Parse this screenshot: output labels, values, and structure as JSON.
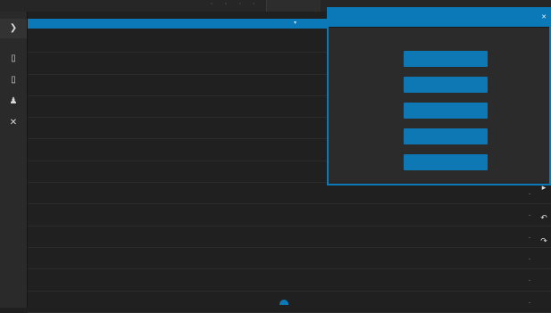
{
  "topbar": {
    "title": ""
  },
  "sidebar": {
    "items": [
      {
        "icon": "expand-icon",
        "glyph": "❯",
        "label": ""
      },
      {
        "icon": "document-icon",
        "glyph": "▯",
        "label": ""
      },
      {
        "icon": "page-icon",
        "glyph": "▯",
        "label": ""
      },
      {
        "icon": "person-icon",
        "glyph": "♟",
        "label": ""
      },
      {
        "icon": "tools-icon",
        "glyph": "✕",
        "label": ""
      }
    ]
  },
  "list": {
    "header": "",
    "rows": [
      {
        "label": "",
        "id": "",
        "desc": ""
      },
      {
        "label": "",
        "id": "",
        "desc": ""
      },
      {
        "label": "",
        "id": "",
        "desc": ""
      },
      {
        "label": "",
        "id": "",
        "desc": ""
      },
      {
        "label": "",
        "id": "",
        "desc": ""
      },
      {
        "label": "",
        "id": "",
        "desc": ""
      },
      {
        "label": "",
        "id": "",
        "desc": ""
      },
      {
        "label": "",
        "id": "",
        "desc": ""
      },
      {
        "label": "",
        "id": "",
        "desc": ""
      },
      {
        "label": "",
        "id": "",
        "desc": ""
      },
      {
        "label": "",
        "id": "",
        "desc": ""
      },
      {
        "label": "",
        "id": "",
        "desc": ""
      },
      {
        "label": "",
        "id": "",
        "desc": ""
      }
    ]
  },
  "dialog": {
    "title": "",
    "buttons": [
      "",
      "",
      "",
      "",
      ""
    ]
  },
  "colors": {
    "accent": "#0b78b8",
    "background": "#1f1f1f",
    "panel": "#282828"
  }
}
